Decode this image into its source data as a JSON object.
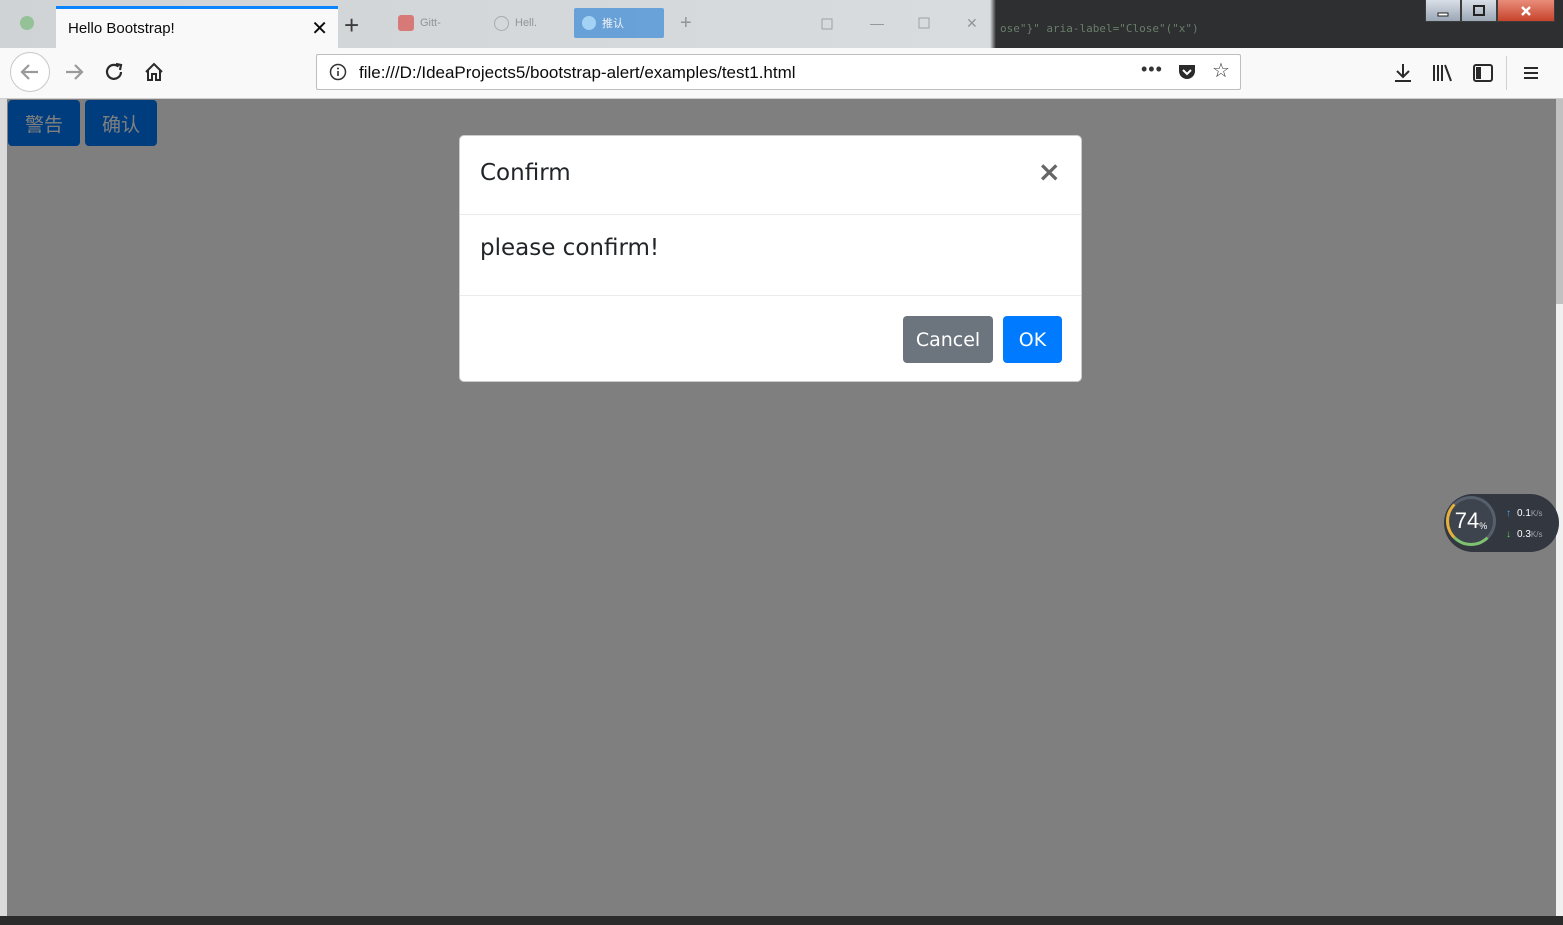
{
  "browser": {
    "active_tab_title": "Hello Bootstrap!",
    "url": "file:///D:/IdeaProjects5/bootstrap-alert/examples/test1.html",
    "new_tab_symbol": "+",
    "tab_close_symbol": "✕",
    "more_symbol": "•••",
    "accent_color": "#0a84ff",
    "bg_tabs": [
      {
        "label": "Gitt-",
        "icon": "red-tab-icon"
      },
      {
        "label": "Hell.",
        "icon": "globe-icon"
      },
      {
        "label": "推认",
        "icon": "blue-tab-icon"
      }
    ],
    "code_hint": "ose\"}\" aria-label=\"Close\"(\"x\")",
    "window_controls": {
      "minimize": "—",
      "maximize": "□",
      "close": "✕"
    }
  },
  "page": {
    "buttons": [
      {
        "label": "警告"
      },
      {
        "label": "确认"
      }
    ],
    "button_color": "#007bff"
  },
  "modal": {
    "title": "Confirm",
    "close_symbol": "×",
    "body": "please confirm!",
    "cancel_label": "Cancel",
    "ok_label": "OK",
    "cancel_color": "#6c757d",
    "ok_color": "#007bff"
  },
  "speed_widget": {
    "percent": "74",
    "percent_sign": "%",
    "up_value": "0.1",
    "down_value": "0.3",
    "unit": "K/s"
  }
}
